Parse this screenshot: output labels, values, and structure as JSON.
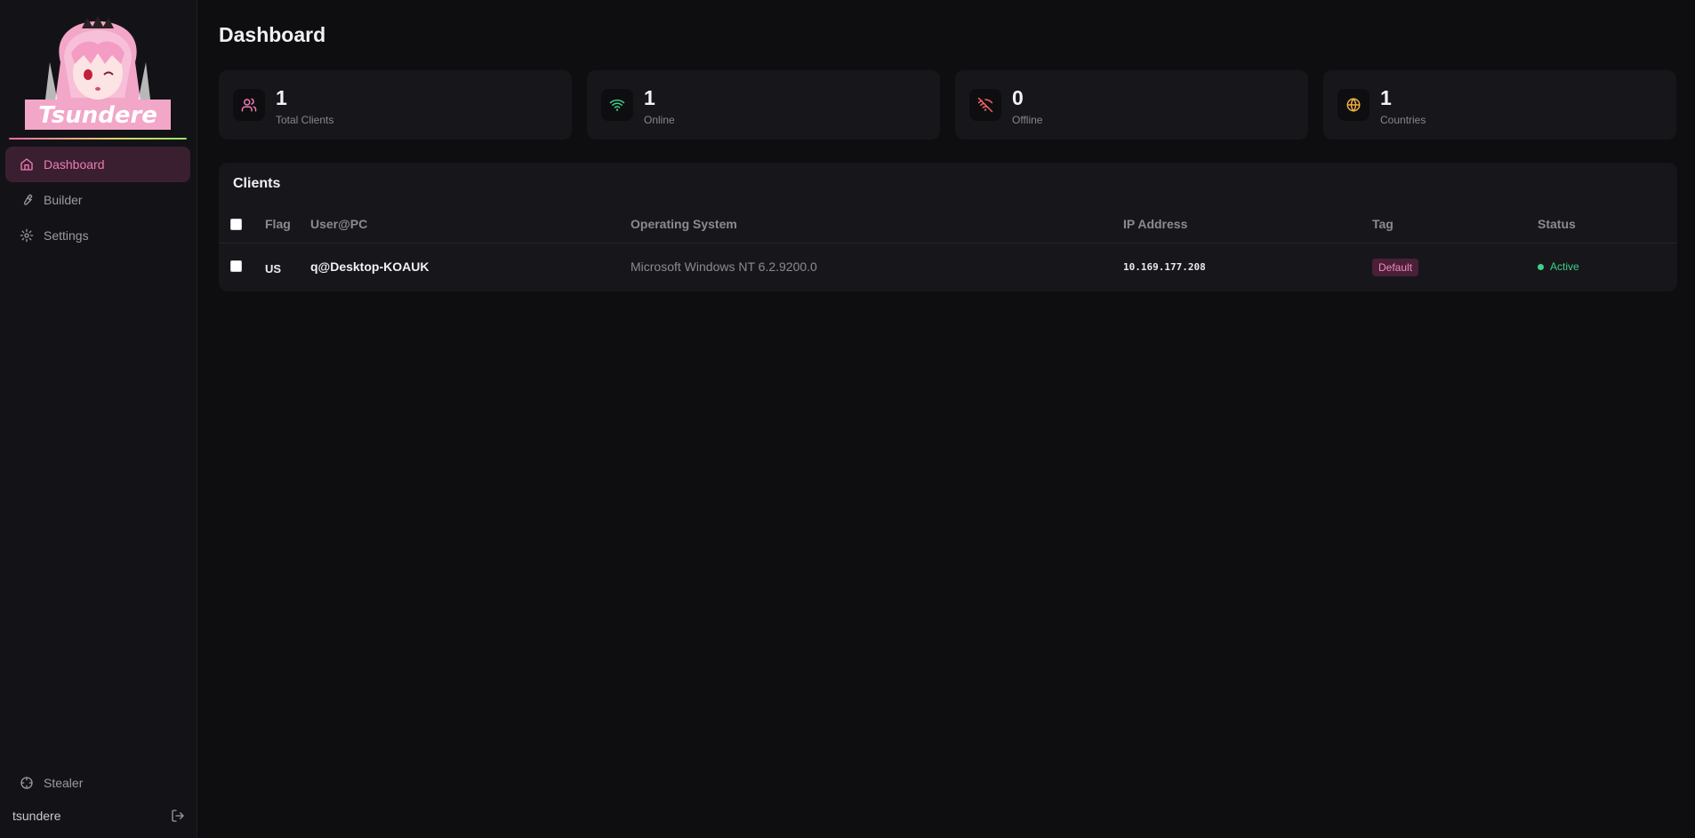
{
  "sidebar": {
    "logo_text": "Tsundere",
    "nav": [
      {
        "label": "Dashboard",
        "icon": "home-icon",
        "active": true
      },
      {
        "label": "Builder",
        "icon": "wrench-icon",
        "active": false
      },
      {
        "label": "Settings",
        "icon": "gear-icon",
        "active": false
      }
    ],
    "bottom_item": {
      "label": "Stealer",
      "icon": "crosshair-icon"
    },
    "username": "tsundere",
    "logout_icon": "logout-icon"
  },
  "page": {
    "title": "Dashboard"
  },
  "stats": [
    {
      "value": "1",
      "label": "Total Clients",
      "icon": "users-icon",
      "color": "#f07bb4"
    },
    {
      "value": "1",
      "label": "Online",
      "icon": "wifi-icon",
      "color": "#3ed08a"
    },
    {
      "value": "0",
      "label": "Offline",
      "icon": "wifi-off-icon",
      "color": "#f06464"
    },
    {
      "value": "1",
      "label": "Countries",
      "icon": "globe-icon",
      "color": "#f0b040"
    }
  ],
  "clients": {
    "title": "Clients",
    "columns": [
      "Flag",
      "User@PC",
      "Operating System",
      "IP Address",
      "Tag",
      "Status"
    ],
    "rows": [
      {
        "flag": "US",
        "user_pc": "q@Desktop-KOAUK",
        "os": "Microsoft Windows NT 6.2.9200.0",
        "ip": "10.169.177.208",
        "tag": "Default",
        "status": "Active"
      }
    ]
  },
  "colors": {
    "accent": "#f07bb4",
    "background": "#0e0e11",
    "card": "#17171b",
    "active_status": "#3ed08a"
  }
}
